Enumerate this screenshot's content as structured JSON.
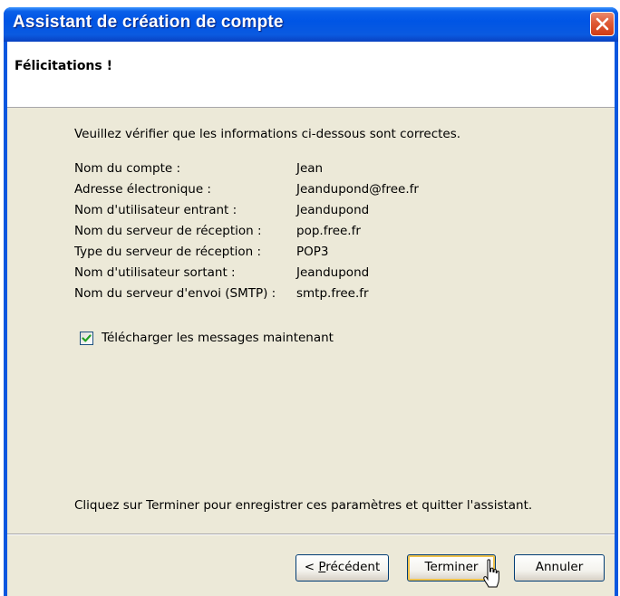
{
  "window": {
    "title": "Assistant de création de compte"
  },
  "header": {
    "heading": "Félicitations !"
  },
  "intro_text": "Veuillez vérifier que les informations ci-dessous sont correctes.",
  "info": [
    {
      "label": "Nom du compte :",
      "value": "Jean"
    },
    {
      "label": "Adresse électronique :",
      "value": "Jeandupond@free.fr"
    },
    {
      "label": "Nom d'utilisateur entrant :",
      "value": "Jeandupond"
    },
    {
      "label": "Nom du serveur de réception :",
      "value": "pop.free.fr"
    },
    {
      "label": "Type du serveur de réception :",
      "value": "POP3"
    },
    {
      "label": "Nom d'utilisateur sortant :",
      "value": "Jeandupond"
    },
    {
      "label": "Nom du serveur d'envoi (SMTP) :",
      "value": "smtp.free.fr"
    }
  ],
  "download_checkbox": {
    "label": "Télécharger les messages maintenant",
    "checked": true
  },
  "footer_text": "Cliquez sur Terminer pour enregistrer ces paramètres et quitter l'assistant.",
  "buttons": {
    "previous_prefix": "< ",
    "previous_access": "P",
    "previous_rest": "récédent",
    "finish": "Terminer",
    "cancel": "Annuler"
  },
  "colors": {
    "title_bar": "#0055e5",
    "dialog_bg": "#ece9d8",
    "close_button": "#df5a36"
  }
}
